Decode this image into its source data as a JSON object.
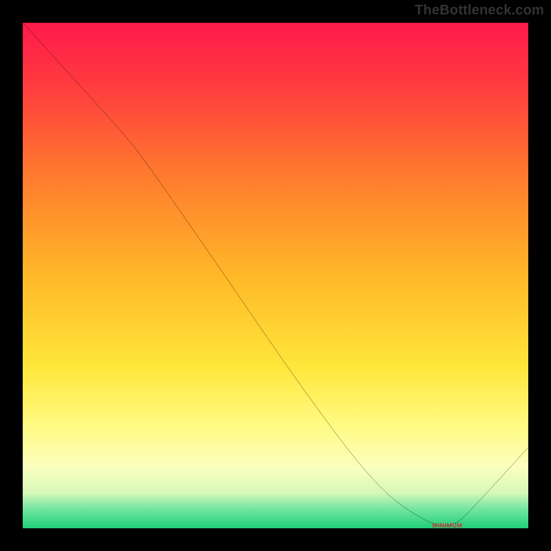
{
  "watermark": "TheBottleneck.com",
  "minimum_label": "MINIMUM",
  "chart_data": {
    "type": "line",
    "title": "",
    "xlabel": "",
    "ylabel": "",
    "xlim": [
      0,
      100
    ],
    "ylim": [
      0,
      100
    ],
    "grid": false,
    "background_gradient": {
      "stops": [
        {
          "pct": 0,
          "color": "#ff1a4b"
        },
        {
          "pct": 12,
          "color": "#ff3a3f"
        },
        {
          "pct": 30,
          "color": "#ff7a2e"
        },
        {
          "pct": 50,
          "color": "#ffb828"
        },
        {
          "pct": 68,
          "color": "#ffe63a"
        },
        {
          "pct": 80,
          "color": "#fffb85"
        },
        {
          "pct": 88,
          "color": "#fbffbf"
        },
        {
          "pct": 93,
          "color": "#d6f8b8"
        },
        {
          "pct": 96,
          "color": "#78e6a1"
        },
        {
          "pct": 100,
          "color": "#1fd07a"
        }
      ]
    },
    "series": [
      {
        "name": "bottleneck-curve",
        "color": "#000000",
        "x": [
          0,
          10,
          20,
          24,
          40,
          55,
          70,
          80,
          85,
          90,
          100
        ],
        "y": [
          100,
          89,
          78,
          73,
          50,
          28,
          8,
          1,
          0,
          5,
          16
        ]
      }
    ],
    "annotations": [
      {
        "name": "minimum-marker",
        "x": 84,
        "y": 0.5,
        "text_key": "minimum_label"
      }
    ]
  }
}
